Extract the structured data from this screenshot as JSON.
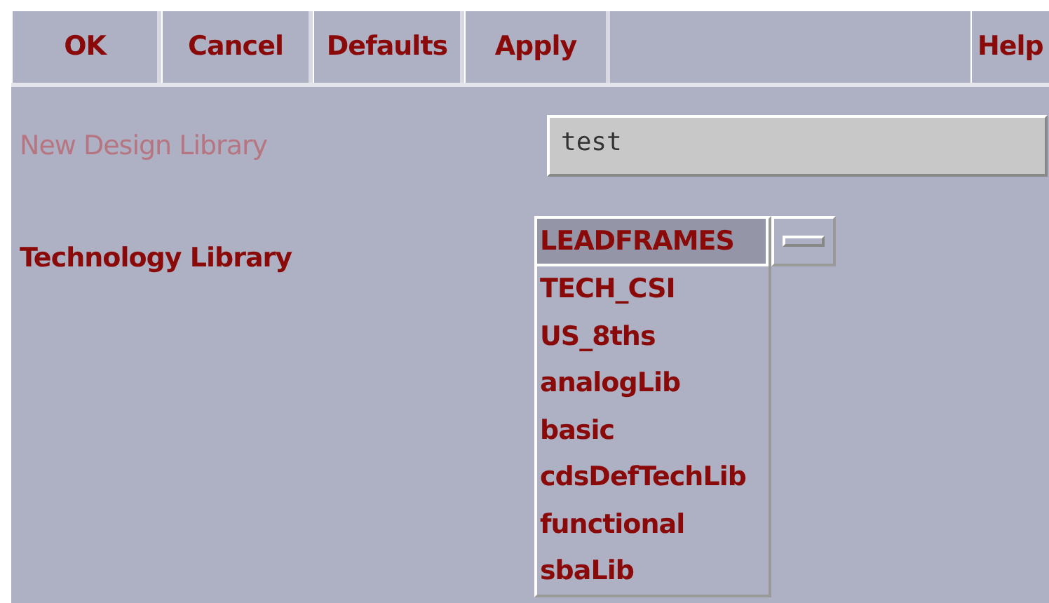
{
  "buttons": [
    {
      "label": "OK",
      "kind": "left"
    },
    {
      "label": "Cancel",
      "kind": "left"
    },
    {
      "label": "Defaults",
      "kind": "left"
    },
    {
      "label": "Apply",
      "kind": "left"
    },
    {
      "label": "Help",
      "kind": "right"
    }
  ],
  "new_design_library": {
    "label": "New Design Library",
    "value": "test",
    "disabled": true
  },
  "technology_library": {
    "label": "Technology Library",
    "expanded": true,
    "options": [
      {
        "label": "LEADFRAMES",
        "selected": true
      },
      {
        "label": "TECH_CSI",
        "selected": false
      },
      {
        "label": "US_8ths",
        "selected": false
      },
      {
        "label": "analogLib",
        "selected": false
      },
      {
        "label": "basic",
        "selected": false
      },
      {
        "label": "cdsDefTechLib",
        "selected": false
      },
      {
        "label": "functional",
        "selected": false
      },
      {
        "label": "sbaLib",
        "selected": false
      }
    ]
  }
}
